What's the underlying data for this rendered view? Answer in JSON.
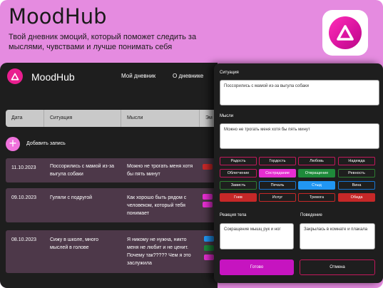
{
  "promo": {
    "title": "MoodHub",
    "description": "Твой дневник эмоций,  который поможет следить за мыслями, чувствами и лучше понимать себя"
  },
  "app": {
    "name": "MoodHub",
    "nav": [
      "Мой дневник",
      "О дневнике"
    ],
    "table_headers": [
      "Дата",
      "Ситуация",
      "Мысли",
      "Эм"
    ],
    "add_label": "Добавить запись",
    "entries": [
      {
        "date": "11.10.2023",
        "situation": "Поссорились с мамой из-за выгула собаки",
        "thought": "Можно не трогать меня хотя бы пять минут",
        "tag_colors": [
          "#c62828"
        ]
      },
      {
        "date": "09.10.2023",
        "situation": "Гуляли с подругой",
        "thought": "Как хорошо быть рядом с человеком, который тебя понимает",
        "tag_colors": [
          "#e62ed1",
          "#e62ed1"
        ]
      },
      {
        "date": "08.10.2023",
        "situation": "Сижу в школе, много мыслей в голове",
        "thought": "Я никому не нужна, никто меня не любит и не ценит. Почему так????? Чем я это заслужила",
        "tag_colors": [
          "#2196f3",
          "#1e8a3a",
          "#e62ed1"
        ]
      }
    ]
  },
  "modal": {
    "situation_label": "Ситуация",
    "situation_value": "Поссорились с мамой из-за выгула собаки",
    "thoughts_label": "Мысли",
    "thoughts_value": "Можно не трогать меня хотя бы пять минут",
    "emotions": [
      [
        "Радость",
        "Гордость",
        "Любовь",
        "Надежда"
      ],
      [
        "Облегчение",
        "Сострадание",
        "Отвращение",
        "Ревность"
      ],
      [
        "Зависть",
        "Печаль",
        "Стыд",
        "Вина"
      ],
      [
        "Гнев",
        "Испуг",
        "Тревога",
        "Обида"
      ]
    ],
    "body_label": "Реакция тела",
    "body_value": "Сокращение мышц рук и ног",
    "behavior_label": "Поведение",
    "behavior_value": "Закрылась в комнате и плакала",
    "ok_label": "Готово",
    "cancel_label": "Отмена"
  },
  "colors": {
    "accent": "#e91e8f",
    "promo_bg": "#e58be0",
    "app_bg": "#1e1e1e",
    "row_bg": "#4d3849"
  },
  "icons": {
    "logo": "triangle-logo-icon",
    "add": "plus-icon"
  }
}
